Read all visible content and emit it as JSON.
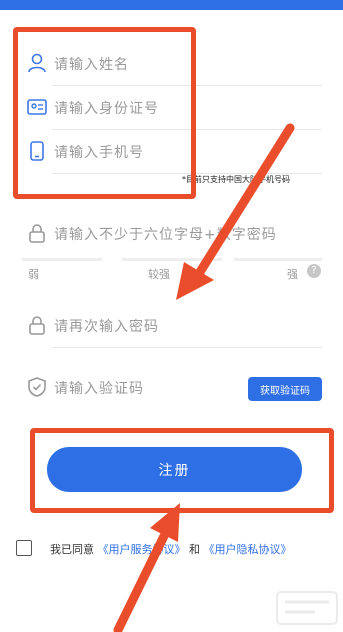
{
  "form": {
    "name_placeholder": "请输入姓名",
    "id_placeholder": "请输入身份证号",
    "phone_placeholder": "请输入手机号",
    "phone_hint": "*目前只支持中国大陆手机号码",
    "password_placeholder": "请输入不少于六位字母+数字密码",
    "confirm_placeholder": "请再次输入密码",
    "code_placeholder": "请输入验证码",
    "get_code_label": "获取验证码",
    "register_label": "注册"
  },
  "strength": {
    "weak": "弱",
    "medium": "较强",
    "strong": "强",
    "help": "?"
  },
  "agreement": {
    "prefix": "我已同意",
    "service": "《用户服务协议》",
    "and": "和",
    "privacy": "《用户隐私协议》"
  },
  "colors": {
    "accent": "#2f6fe6",
    "annotation": "#ea4d2b"
  }
}
